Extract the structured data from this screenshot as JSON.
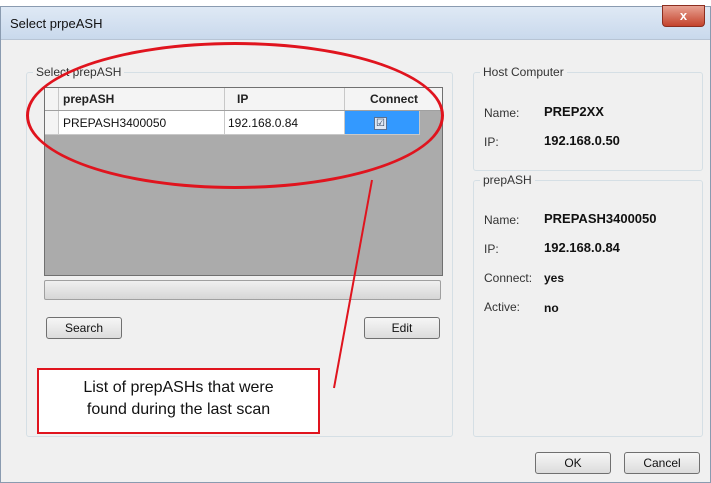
{
  "window": {
    "title": "Select prpeASH",
    "close_label": "x"
  },
  "left_group": {
    "label": "Select prepASH",
    "columns": [
      "prepASH",
      "IP",
      "Connect"
    ],
    "rows": [
      {
        "name": "PREPASH3400050",
        "ip": "192.168.0.84",
        "connect": "☑"
      }
    ],
    "search_label": "Search",
    "edit_label": "Edit"
  },
  "host_group": {
    "label": "Host Computer",
    "name_label": "Name:",
    "name_value": "PREP2XX",
    "ip_label": "IP:",
    "ip_value": "192.168.0.50"
  },
  "prepash_group": {
    "label": "prepASH",
    "name_label": "Name:",
    "name_value": "PREPASH3400050",
    "ip_label": "IP:",
    "ip_value": "192.168.0.84",
    "connect_label": "Connect:",
    "connect_value": "yes",
    "active_label": "Active:",
    "active_value": "no"
  },
  "buttons": {
    "ok": "OK",
    "cancel": "Cancel"
  },
  "annotation": {
    "line1": "List of prepASHs that were",
    "line2": "found during the last scan",
    "color": "#e0141e"
  }
}
